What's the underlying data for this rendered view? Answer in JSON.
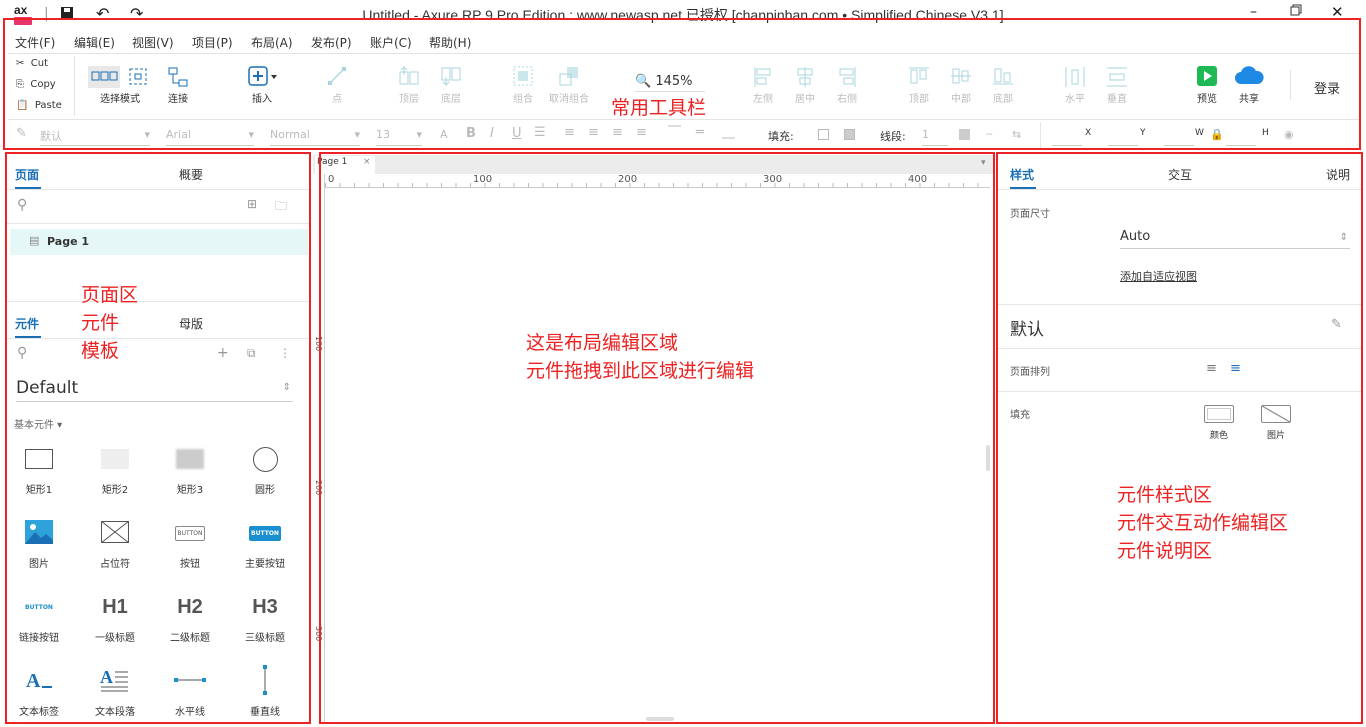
{
  "window": {
    "title": "Untitled - Axure RP 9 Pro Edition : www.newasp.net 已授权    [chanpinban.com • Simplified Chinese V3.1]",
    "logo_text": "ax"
  },
  "menu": [
    "文件(F)",
    "编辑(E)",
    "视图(V)",
    "项目(P)",
    "布局(A)",
    "发布(P)",
    "账户(C)",
    "帮助(H)"
  ],
  "clipboard": {
    "cut": "Cut",
    "copy": "Copy",
    "paste": "Paste"
  },
  "toolbar": {
    "select_mode": "选择模式",
    "connect": "连接",
    "insert": "插入",
    "point": "点",
    "top_layer": "顶层",
    "bottom_layer": "底层",
    "group": "组合",
    "ungroup": "取消组合",
    "zoom": "145%",
    "align_left": "左侧",
    "align_center": "居中",
    "align_right": "右侧",
    "align_top": "顶部",
    "align_middle": "中部",
    "align_bottom": "底部",
    "distribute_h": "水平",
    "distribute_v": "垂直",
    "preview": "预览",
    "share": "共享",
    "login": "登录"
  },
  "format": {
    "style": "默认",
    "font": "Arial",
    "weight": "Normal",
    "size": "13",
    "fill_label": "填充:",
    "line_label": "线段:",
    "line_value": "1",
    "x_label": "X",
    "y_label": "Y",
    "w_label": "W",
    "h_label": "H"
  },
  "left_panel": {
    "tab_pages": "页面",
    "tab_outline": "概要",
    "pages": [
      "Page 1"
    ],
    "tab_widgets": "元件",
    "tab_masters": "母版",
    "library": "Default",
    "category": "基本元件 ▾",
    "widgets": [
      "矩形1",
      "矩形2",
      "矩形3",
      "圆形",
      "图片",
      "占位符",
      "按钮",
      "主要按钮",
      "链接按钮",
      "一级标题",
      "二级标题",
      "三级标题",
      "文本标签",
      "文本段落",
      "水平线",
      "垂直线"
    ],
    "button_text": "BUTTON",
    "h1": "H1",
    "h2": "H2",
    "h3": "H3"
  },
  "canvas": {
    "tab": "Page 1",
    "ruler_h": [
      "0",
      "100",
      "200",
      "300",
      "400"
    ],
    "ruler_v": [
      "100",
      "200",
      "300"
    ]
  },
  "right_panel": {
    "tab_style": "样式",
    "tab_interaction": "交互",
    "tab_notes": "说明",
    "page_size_label": "页面尺寸",
    "page_size_value": "Auto",
    "adaptive_link": "添加自适应视图",
    "default_label": "默认",
    "page_align_label": "页面排列",
    "fill_label": "填充",
    "fill_color": "颜色",
    "fill_image": "图片"
  },
  "annotations": {
    "toolbar": "常用工具栏",
    "left": [
      "页面区",
      "元件",
      "模板"
    ],
    "canvas": [
      "这是布局编辑区域",
      "元件拖拽到此区域进行编辑"
    ],
    "right": [
      "元件样式区",
      "元件交互动作编辑区",
      "元件说明区"
    ]
  },
  "colors": {
    "accent": "#1a6fb5",
    "annotation": "#ee2222",
    "selection": "#e6f7f8",
    "preview_green": "#1db954",
    "share_blue": "#1e88e5"
  }
}
